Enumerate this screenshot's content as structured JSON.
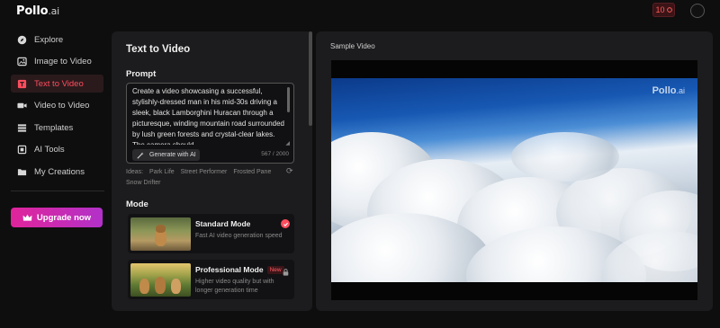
{
  "brand": {
    "logo_main": "Pollo",
    "logo_suffix": ".ai"
  },
  "header": {
    "credits": "10"
  },
  "sidebar": {
    "items": [
      {
        "label": "Explore",
        "icon": "compass-icon"
      },
      {
        "label": "Image to Video",
        "icon": "image-icon"
      },
      {
        "label": "Text to Video",
        "icon": "text-icon",
        "active": true
      },
      {
        "label": "Video to Video",
        "icon": "video-icon"
      },
      {
        "label": "Templates",
        "icon": "templates-icon"
      },
      {
        "label": "AI Tools",
        "icon": "tools-icon"
      },
      {
        "label": "My Creations",
        "icon": "folder-icon"
      }
    ],
    "upgrade_label": "Upgrade now"
  },
  "form": {
    "title": "Text to Video",
    "prompt_label": "Prompt",
    "prompt_text": "Create a video showcasing a successful, stylishly-dressed man in his mid-30s driving a sleek, black Lamborghini Huracan through a picturesque, winding mountain road surrounded by lush green forests and crystal-clear lakes. The camera should",
    "generate_label": "Generate with AI",
    "char_count": "567 / 2000",
    "ideas_label": "Ideas:",
    "ideas": [
      "Park Life",
      "Street Performer",
      "Frosted Pane",
      "Snow Drifter"
    ],
    "mode_label": "Mode",
    "modes": [
      {
        "name": "Standard Mode",
        "desc": "Fast AI video generation speed",
        "selected": true
      },
      {
        "name": "Professional Mode",
        "badge": "New",
        "desc": "Higher video quality but with longer generation time",
        "locked": true
      }
    ]
  },
  "sample": {
    "title": "Sample Video",
    "watermark_main": "Pollo",
    "watermark_suffix": ".ai"
  },
  "colors": {
    "accent": "#ff4d5e",
    "panel": "#1c1c1e",
    "background": "#0e0e0f"
  }
}
